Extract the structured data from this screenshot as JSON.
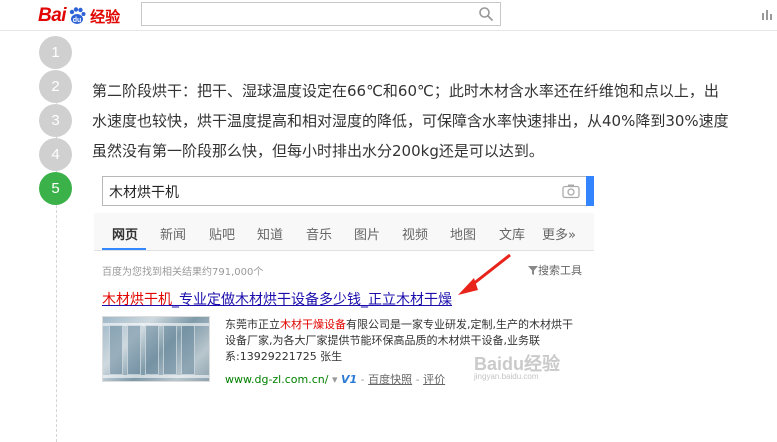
{
  "header": {
    "logo_bai": "Bai",
    "logo_du": "du",
    "logo_jingyan": "经验",
    "search_value": ""
  },
  "steps": [
    "1",
    "2",
    "3",
    "4",
    "5"
  ],
  "active_step": 5,
  "content": {
    "paragraph": "第二阶段烘干：把干、湿球温度设定在66℃和60℃；此时木材含水率还在纤维饱和点以上，出水速度也较快，烘干温度提高和相对湿度的降低，可保障含水率快速排出，从40%降到30%速度虽然没有第一阶段那么快，但每小时排出水分200kg还是可以达到。"
  },
  "screenshot": {
    "query": "木材烘干机",
    "tabs": [
      "网页",
      "新闻",
      "贴吧",
      "知道",
      "音乐",
      "图片",
      "视频",
      "地图",
      "文库",
      "更多»"
    ],
    "active_tab": "网页",
    "stats": "百度为您找到相关结果约791,000个",
    "tools": "搜索工具",
    "result": {
      "title_hl": "木材烘干机",
      "title_rest": "_专业定做木材烘干设备多少钱_正立木材干燥",
      "desc_pre": "东莞市正立",
      "desc_hl": "木材干燥设备",
      "desc_post": "有限公司是一家专业研发,定制,生产的木材烘干设备厂家,为各大厂家提供节能环保高品质的木材烘干设备,业务联系:13929221725 张生",
      "url": "www.dg-zl.com.cn/",
      "v1": "V1",
      "snapshot": "百度快照",
      "review": "评价"
    }
  },
  "watermark": {
    "main": "Baidu经验",
    "sub": "jingyan.baidu.com"
  },
  "colors": {
    "brand_red": "#e10601",
    "step_active": "#3bb249",
    "step_inactive": "#d0d0d0",
    "search_blue": "#3385ff",
    "link_blue": "#1a0dab",
    "url_green": "#008000"
  }
}
